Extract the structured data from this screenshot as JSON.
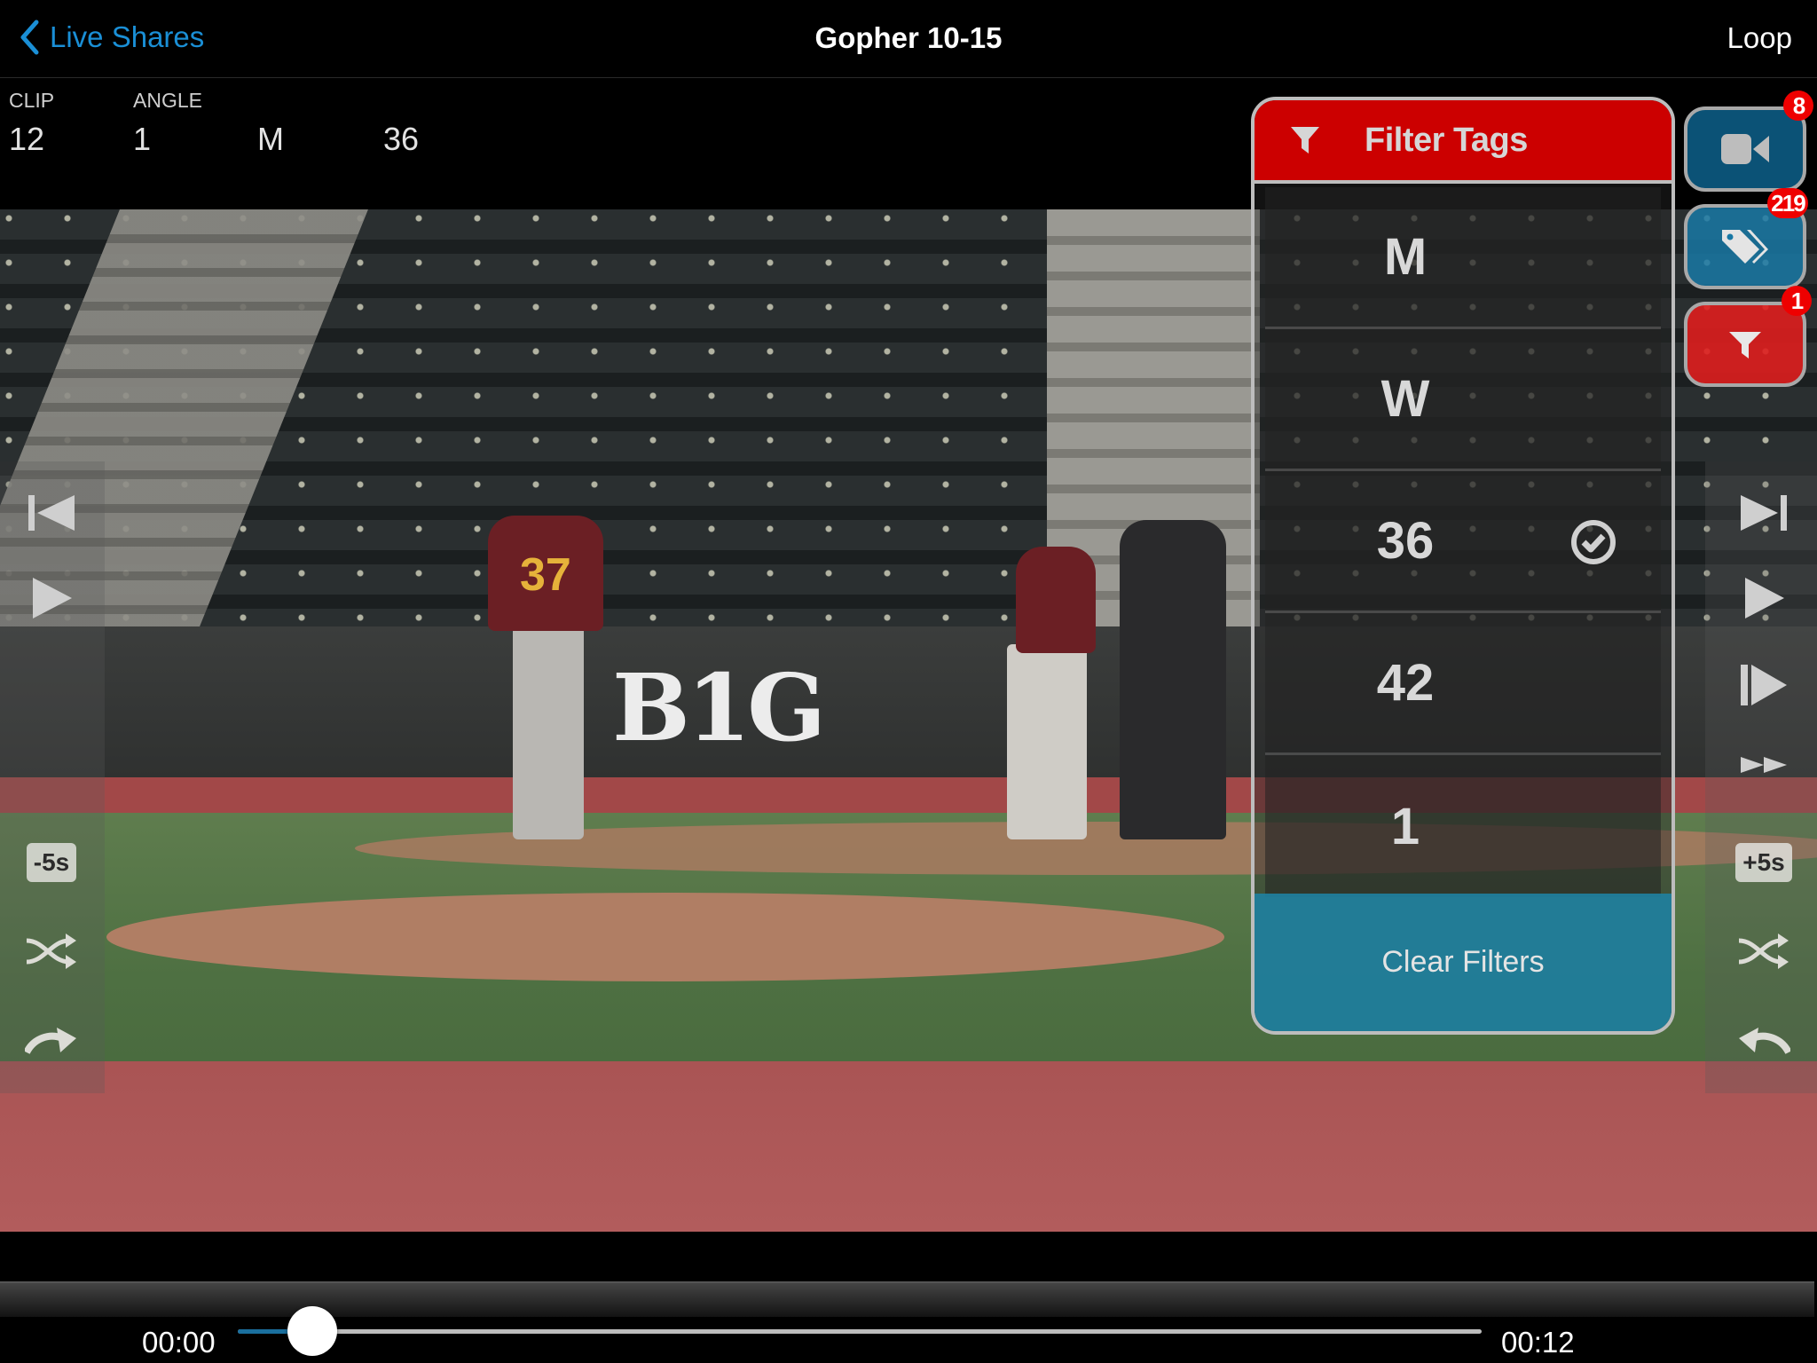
{
  "navbar": {
    "back_label": "Live Shares",
    "title": "Gopher 10-15",
    "right_label": "Loop"
  },
  "clip_info": {
    "columns": [
      {
        "label": "CLIP",
        "value": "12"
      },
      {
        "label": "ANGLE",
        "value": "1"
      },
      {
        "label": "",
        "value": "M"
      },
      {
        "label": "",
        "value": "36"
      }
    ]
  },
  "video": {
    "logo_text": "B1G",
    "jersey_number": "37"
  },
  "left_controls": {
    "items": [
      {
        "icon": "skip-to-start-icon"
      },
      {
        "icon": "play-icon"
      },
      {
        "icon": "skip-back-5s",
        "label": "-5s"
      },
      {
        "icon": "shuffle-icon"
      },
      {
        "icon": "redo-arrow-icon"
      }
    ]
  },
  "right_controls": {
    "items": [
      {
        "icon": "skip-to-end-icon"
      },
      {
        "icon": "play-icon"
      },
      {
        "icon": "step-forward-icon"
      },
      {
        "icon": "fast-forward-icon"
      },
      {
        "icon": "skip-forward-5s",
        "label": "+5s"
      },
      {
        "icon": "shuffle-icon"
      },
      {
        "icon": "undo-arrow-icon"
      }
    ]
  },
  "filter_panel": {
    "title": "Filter Tags",
    "tags": [
      {
        "label": "M",
        "selected": false
      },
      {
        "label": "W",
        "selected": false
      },
      {
        "label": "36",
        "selected": true
      },
      {
        "label": "42",
        "selected": false
      },
      {
        "label": "1",
        "selected": false
      }
    ],
    "clear_label": "Clear Filters",
    "header_color": "#cc0000",
    "clear_color": "#20809e"
  },
  "action_buttons": [
    {
      "name": "video-angles",
      "icon": "video-camera-icon",
      "badge": "8",
      "color": "#0b5276"
    },
    {
      "name": "tags",
      "icon": "tags-icon",
      "badge": "219",
      "color": "#1978a5"
    },
    {
      "name": "filter",
      "icon": "filter-funnel-icon",
      "badge": "1",
      "color": "#de1e1e"
    }
  ],
  "scrubber": {
    "current_time": "00:00",
    "total_time": "00:12",
    "progress_fraction": 0.06
  }
}
